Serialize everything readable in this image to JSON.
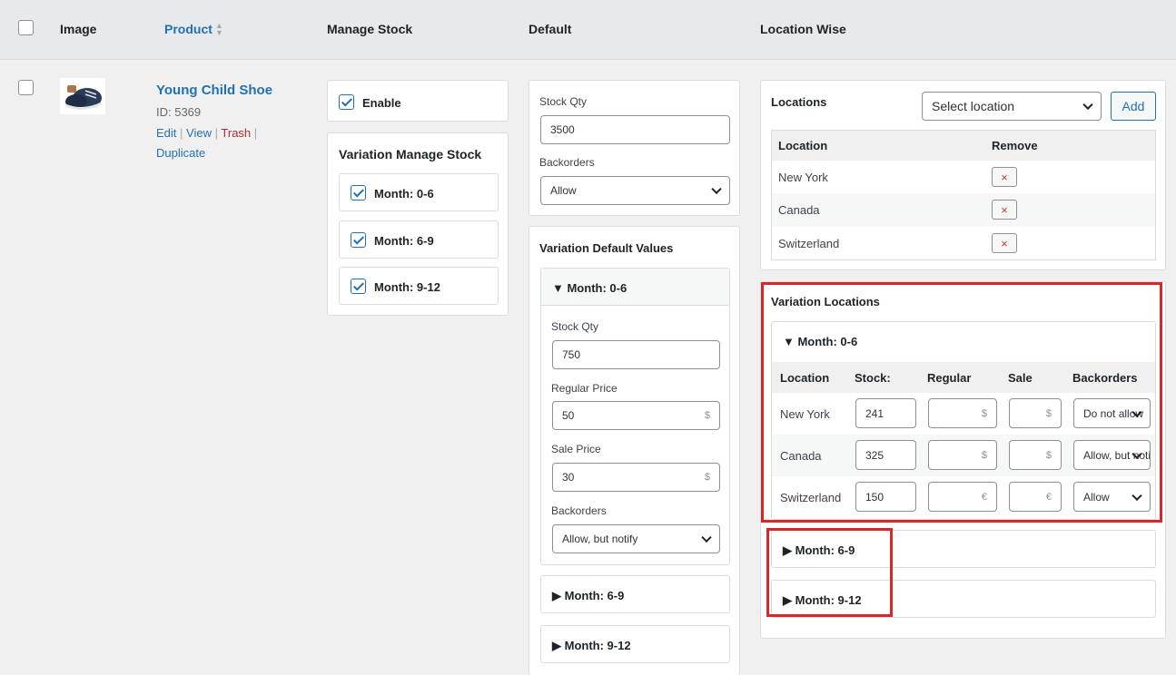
{
  "header": {
    "image": "Image",
    "product": "Product",
    "manage_stock": "Manage Stock",
    "default": "Default",
    "location_wise": "Location Wise"
  },
  "product": {
    "name": "Young Child Shoe",
    "id": "ID: 5369",
    "edit": "Edit",
    "view": "View",
    "trash": "Trash",
    "duplicate": "Duplicate",
    "sep": "|"
  },
  "manage": {
    "enable": "Enable",
    "variation_title": "Variation Manage Stock",
    "variations": [
      "Month: 0-6",
      "Month: 6-9",
      "Month: 9-12"
    ]
  },
  "default": {
    "stock_qty_label": "Stock Qty",
    "stock_qty": "3500",
    "backorders_label": "Backorders",
    "backorders": "Allow",
    "variation_title": "Variation Default Values",
    "open_variation": "▼ Month: 0-6",
    "v_stock_label": "Stock Qty",
    "v_stock": "750",
    "regular_label": "Regular Price",
    "regular": "50",
    "sale_label": "Sale Price",
    "sale": "30",
    "currency": "$",
    "v_backorders_label": "Backorders",
    "v_backorders": "Allow, but notify",
    "closed1": "▶ Month: 6-9",
    "closed2": "▶ Month: 9-12"
  },
  "locations": {
    "title": "Locations",
    "select_placeholder": "Select location",
    "add": "Add",
    "col_location": "Location",
    "col_remove": "Remove",
    "rows": [
      "New York",
      "Canada",
      "Switzerland"
    ],
    "remove_icon": "×"
  },
  "variation_locations": {
    "title": "Variation Locations",
    "open_variation": "▼ Month: 0-6",
    "cols": [
      "Location",
      "Stock:",
      "Regular",
      "Sale",
      "Backorders"
    ],
    "rows": [
      {
        "location": "New York",
        "stock": "241",
        "reg_cur": "$",
        "sale_cur": "$",
        "backorders": "Do not allow"
      },
      {
        "location": "Canada",
        "stock": "325",
        "reg_cur": "$",
        "sale_cur": "$",
        "backorders": "Allow, but notify"
      },
      {
        "location": "Switzerland",
        "stock": "150",
        "reg_cur": "€",
        "sale_cur": "€",
        "backorders": "Allow"
      }
    ],
    "closed1": "▶ Month: 6-9",
    "closed2": "▶ Month: 9-12"
  }
}
